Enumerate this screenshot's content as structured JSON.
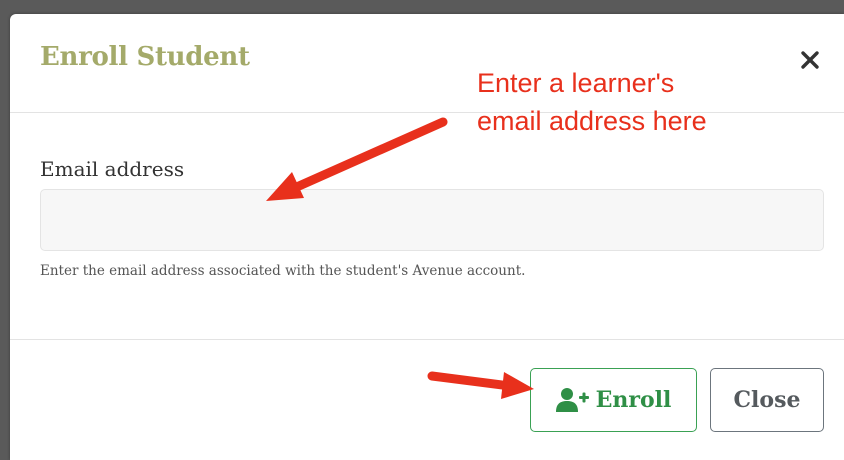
{
  "modal": {
    "title": "Enroll Student",
    "close_icon": "close-x-icon"
  },
  "form": {
    "email_label": "Email address",
    "email_value": "",
    "email_placeholder": "",
    "help_text": "Enter the email address associated with the student's Avenue account."
  },
  "footer": {
    "enroll_label": "Enroll",
    "enroll_icon": "user-plus-icon",
    "close_label": "Close"
  },
  "annotations": {
    "callout_line1": "Enter a learner's",
    "callout_line2": "email address here"
  },
  "colors": {
    "title": "#a4aa6a",
    "enroll_accent": "#2f8f46",
    "annotation_red": "#e8301c"
  }
}
